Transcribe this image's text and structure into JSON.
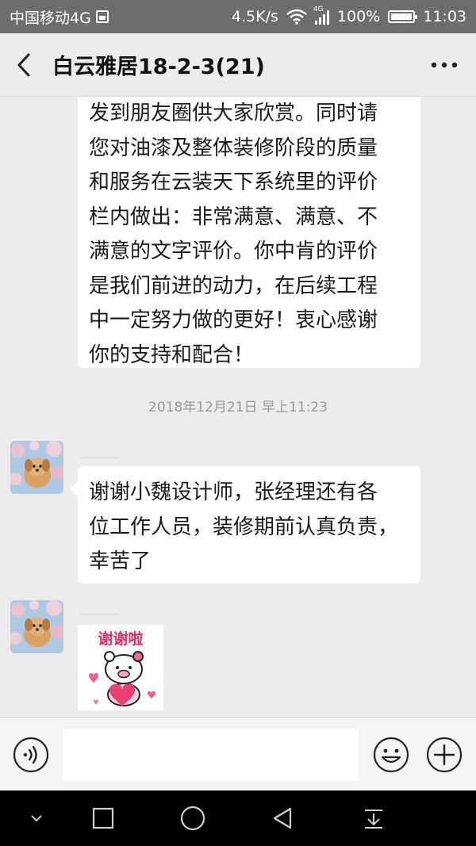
{
  "status_bar": {
    "carrier": "中国移动4G",
    "net_speed": "4.5K/s",
    "network_type": "4G",
    "battery": "100%",
    "time": "11:03"
  },
  "nav": {
    "title": "白云雅居18-2-3",
    "member_count": "(21)"
  },
  "messages": {
    "incoming_1": {
      "lines": [
        "发到朋友圈供大家欣赏。同时请",
        "您对油漆及整体装修阶段的质量",
        "和服务在云装天下系统里的评价",
        "栏内做出：非常满意、满意、不",
        "满意的文字评价。你中肯的评价",
        "是我们前进的动力，在后续工程",
        "中一定努力做的更好！衷心感谢",
        "你的支持和配合！"
      ]
    },
    "timestamp": "2018年12月21日 早上11:23",
    "incoming_2": {
      "lines": [
        "谢谢小魏设计师，张经理还有各",
        "位工作人员，装修期前认真负责，",
        "幸苦了"
      ]
    },
    "sticker": {
      "text": "谢谢啦"
    }
  },
  "input": {
    "placeholder": ""
  },
  "colors": {
    "background": "#ececec",
    "status_bar": "#6d6d6d",
    "bubble": "#ffffff",
    "sticker_text": "#e0306a"
  }
}
